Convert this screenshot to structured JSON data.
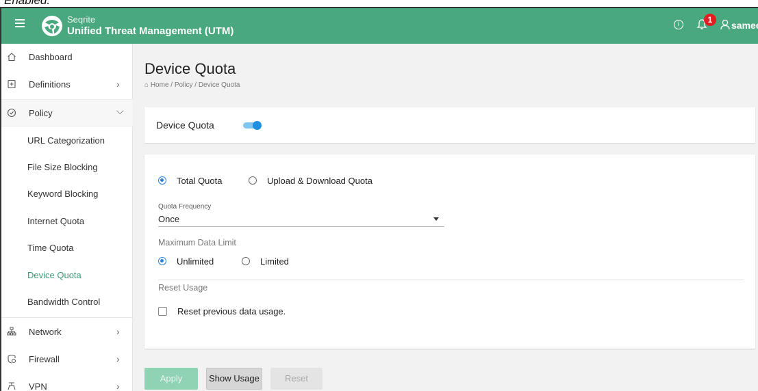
{
  "header": {
    "brand_sub": "Seqrite",
    "brand_title": "Unified Threat Management (UTM)",
    "notification_count": "1",
    "username": "sameer"
  },
  "caption_text": "Enabled.",
  "sidebar": {
    "items": [
      {
        "label": "Dashboard",
        "icon": "home-icon"
      },
      {
        "label": "Definitions",
        "icon": "plus-square-icon"
      },
      {
        "label": "Policy",
        "icon": "shield-icon"
      },
      {
        "label": "Network",
        "icon": "network-icon"
      },
      {
        "label": "Firewall",
        "icon": "firewall-icon"
      },
      {
        "label": "VPN",
        "icon": "vpn-icon"
      }
    ],
    "policy_subitems": [
      "URL Categorization",
      "File Size Blocking",
      "Keyword Blocking",
      "Internet Quota",
      "Time Quota",
      "Device Quota",
      "Bandwidth Control"
    ],
    "active_subitem": "Device Quota"
  },
  "main": {
    "title": "Device Quota",
    "breadcrumb": "⌂ Home / Policy / Device Quota",
    "toggle_label": "Device Quota",
    "toggle_on": true,
    "quota_type_options": [
      "Total Quota",
      "Upload & Download Quota"
    ],
    "quota_type_selected": "Total Quota",
    "frequency_label": "Quota Frequency",
    "frequency_value": "Once",
    "max_limit_label": "Maximum Data Limit",
    "limit_options": [
      "Unlimited",
      "Limited"
    ],
    "limit_selected": "Unlimited",
    "reset_section_label": "Reset Usage",
    "reset_checkbox_label": "Reset previous data usage.",
    "reset_checked": false
  },
  "buttons": {
    "apply": "Apply",
    "show_usage": "Show Usage",
    "reset": "Reset"
  },
  "colors": {
    "brand": "#4aa87e",
    "accent": "#3a9b73",
    "toggle": "#1e8fe0",
    "badge": "#e02020"
  }
}
